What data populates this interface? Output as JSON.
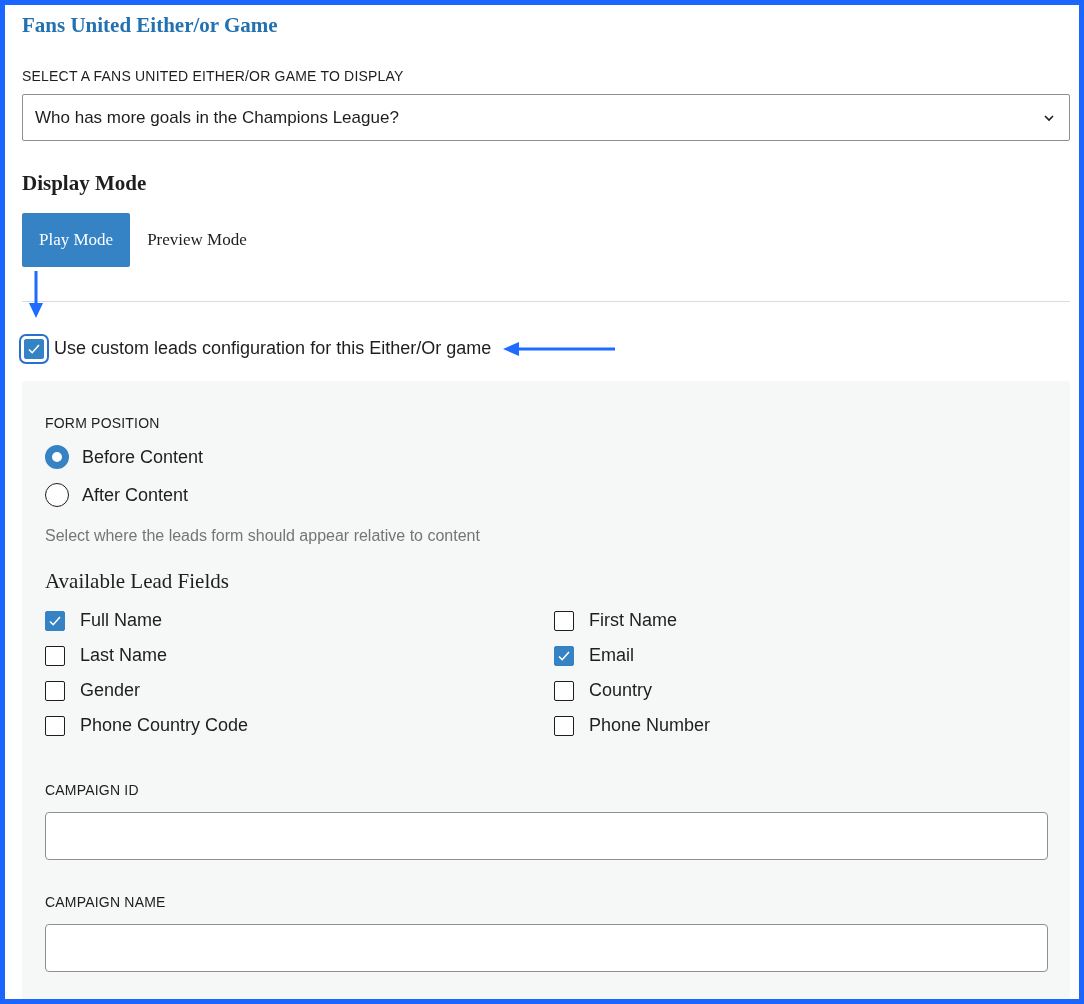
{
  "title": "Fans United Either/or Game",
  "game_select": {
    "label": "SELECT A FANS UNITED EITHER/OR GAME TO DISPLAY",
    "value": "Who has more goals in the Champions League?"
  },
  "display_mode": {
    "heading": "Display Mode",
    "modes": [
      {
        "label": "Play Mode",
        "selected": true
      },
      {
        "label": "Preview Mode",
        "selected": false
      }
    ]
  },
  "custom_leads": {
    "label": "Use custom leads configuration for this Either/Or game",
    "checked": true
  },
  "form_position": {
    "label": "FORM POSITION",
    "options": [
      {
        "label": "Before Content",
        "selected": true
      },
      {
        "label": "After Content",
        "selected": false
      }
    ],
    "help": "Select where the leads form should appear relative to content"
  },
  "lead_fields": {
    "heading": "Available Lead Fields",
    "fields": [
      {
        "label": "Full Name",
        "checked": true
      },
      {
        "label": "First Name",
        "checked": false
      },
      {
        "label": "Last Name",
        "checked": false
      },
      {
        "label": "Email",
        "checked": true
      },
      {
        "label": "Gender",
        "checked": false
      },
      {
        "label": "Country",
        "checked": false
      },
      {
        "label": "Phone Country Code",
        "checked": false
      },
      {
        "label": "Phone Number",
        "checked": false
      }
    ]
  },
  "campaign_fields": [
    {
      "label": "CAMPAIGN ID"
    },
    {
      "label": "CAMPAIGN NAME"
    }
  ]
}
